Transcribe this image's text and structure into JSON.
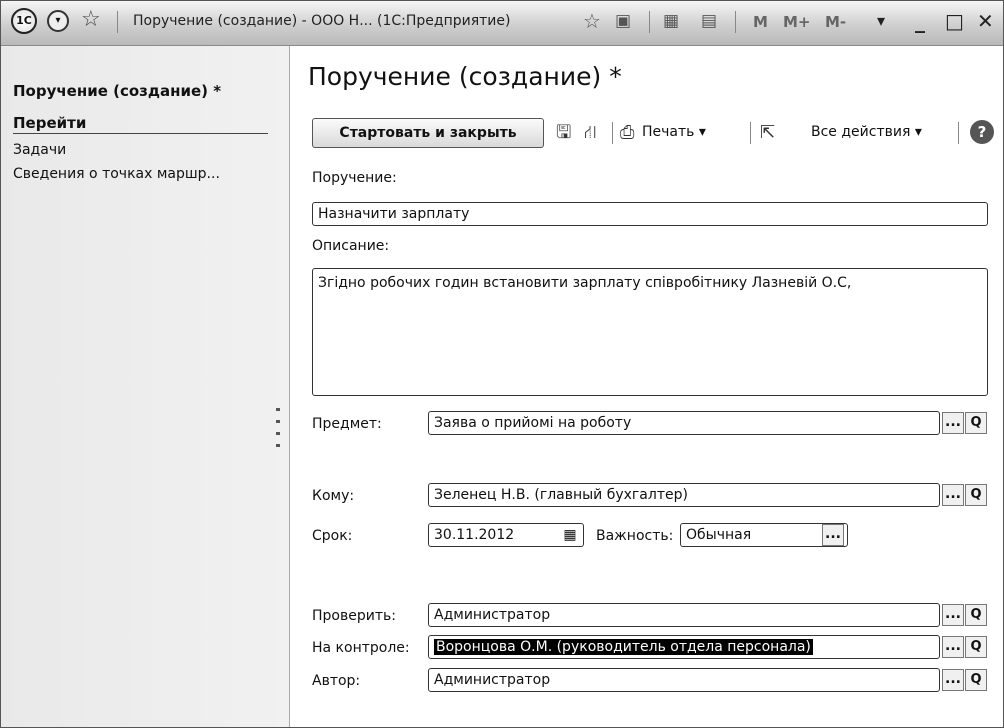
{
  "window": {
    "title": "Поручение (создание) - ООО Н...  (1С:Предприятие)",
    "logo": "1С",
    "memory_buttons": [
      "M",
      "M+",
      "M-"
    ]
  },
  "sidebar": {
    "title": "Поручение (создание) *",
    "section": "Перейти",
    "items": [
      {
        "label": "Задачи"
      },
      {
        "label": "Сведения о точках маршр..."
      }
    ]
  },
  "form": {
    "title": "Поручение (создание) *",
    "toolbar": {
      "start_close": "Стартовать и закрыть",
      "print": "Печать ▾",
      "all_actions": "Все действия ▾",
      "help": "?"
    },
    "instruction_label": "Поручение:",
    "instruction_value": "Назначити зарплату",
    "description_label": "Описание:",
    "description_value": "Згідно робочих годин встановити зарплату співробітнику Лазневій О.С,",
    "subject_label": "Предмет:",
    "subject_value": "Заява о прийомі на роботу",
    "to_label": "Кому:",
    "to_value": "Зеленец Н.В. (главный бухгалтер)",
    "deadline_label": "Срок:",
    "deadline_value": "30.11.2012",
    "importance_label": "Важность:",
    "importance_value": "Обычная",
    "check_label": "Проверить:",
    "check_value": "Администратор",
    "control_label": "На контроле:",
    "control_value": "Воронцова О.М. (руководитель отдела персонала)",
    "author_label": "Автор:",
    "author_value": "Администратор",
    "pick_glyph": "...",
    "search_glyph": "Q"
  },
  "icons": [
    "1c-logo-icon",
    "nav-menu-icon",
    "favorite-star-icon",
    "add-favorite-icon",
    "history-icon",
    "calculator-icon",
    "calendar-icon",
    "minimize-icon",
    "restore-icon",
    "close-icon",
    "save-icon",
    "structure-icon",
    "printer-icon",
    "link-icon",
    "help-icon",
    "search-icon",
    "calendar-picker-icon"
  ]
}
